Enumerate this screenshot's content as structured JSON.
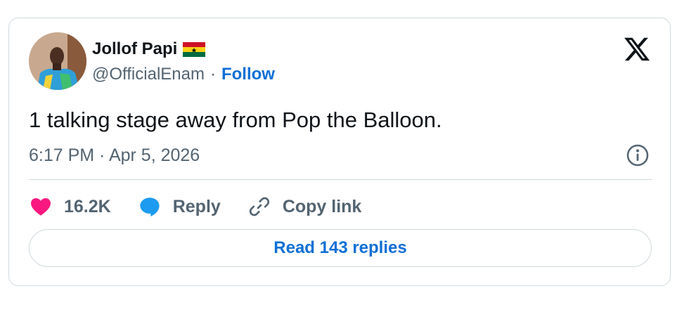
{
  "author": {
    "name": "Jollof Papi",
    "handle": "@OfficialEnam",
    "separator": "·",
    "follow_label": "Follow",
    "flag_icon": "ghana-flag-icon"
  },
  "tweet": {
    "text": "1 talking stage away from Pop the Balloon.",
    "timestamp": "6:17 PM · Apr 5, 2026"
  },
  "actions": {
    "likes": "16.2K",
    "reply_label": "Reply",
    "copy_link_label": "Copy link"
  },
  "read_replies_label": "Read 143 replies",
  "colors": {
    "like": "#f91880",
    "reply": "#1d9bf0",
    "link": "#0f6fd6",
    "secondary_text": "#536471",
    "border": "#cfd9de"
  },
  "icons": [
    "x-logo-icon",
    "info-icon",
    "heart-icon",
    "reply-bubble-icon",
    "link-icon"
  ]
}
